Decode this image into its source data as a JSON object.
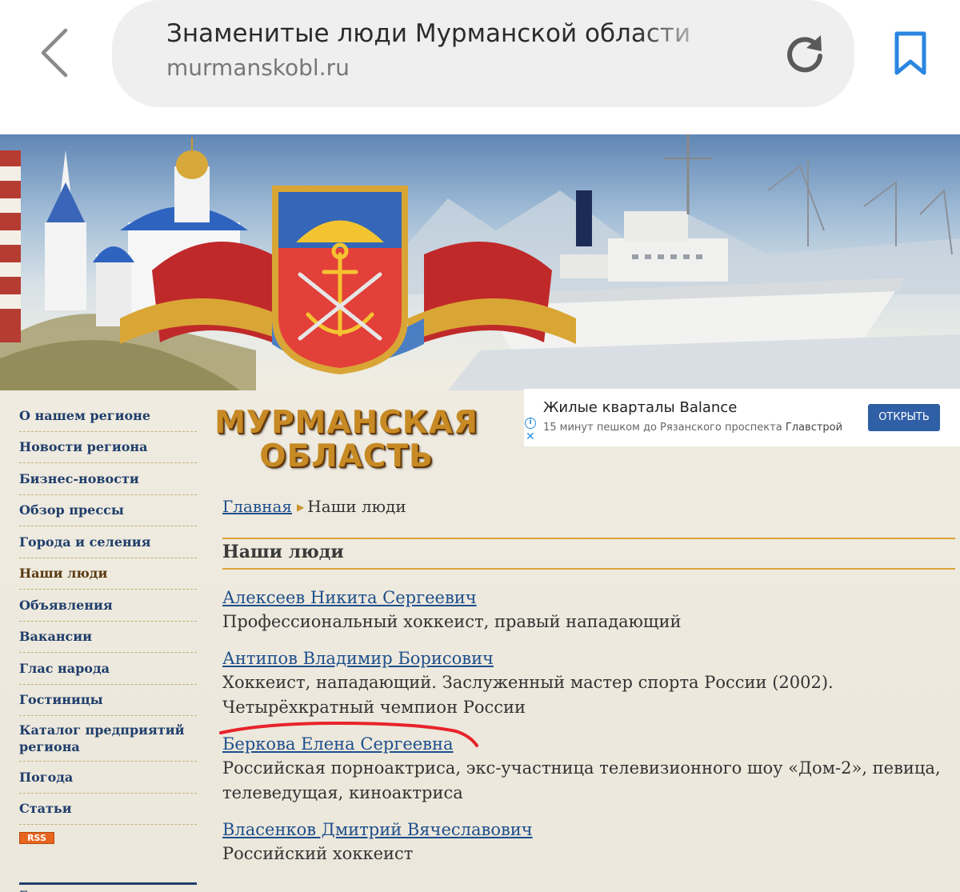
{
  "browser": {
    "page_title": "Знаменитые люди Мурманской области",
    "domain": "murmanskobl.ru"
  },
  "header": {
    "site_title_line1": "МУРМАНСКАЯ",
    "site_title_line2": "ОБЛАСТЬ"
  },
  "ad": {
    "title": "Жилые кварталы Balance",
    "subtitle": "15 минут пешком до Рязанского проспекта",
    "brand": "Главстрой",
    "button": "ОТКРЫТЬ",
    "info_symbol": "i",
    "close_symbol": "✕"
  },
  "sidebar": {
    "items": [
      {
        "label": "О нашем регионе"
      },
      {
        "label": "Новости региона"
      },
      {
        "label": "Бизнес-новости"
      },
      {
        "label": "Обзор прессы"
      },
      {
        "label": "Города и селения"
      },
      {
        "label": "Наши люди",
        "active": true
      },
      {
        "label": "Объявления"
      },
      {
        "label": "Вакансии"
      },
      {
        "label": "Глас народа"
      },
      {
        "label": "Гостиницы"
      },
      {
        "label": "Каталог предприятий региона"
      },
      {
        "label": "Погода"
      },
      {
        "label": "Статьи"
      }
    ],
    "rss_label": "RSS",
    "bottom_partial": "Г"
  },
  "breadcrumb": {
    "home": "Главная",
    "separator": "▶",
    "current": "Наши люди"
  },
  "section": {
    "title": "Наши люди"
  },
  "people": [
    {
      "name": "Алексеев Никита Сергеевич",
      "description": "Профессиональный хоккеист, правый нападающий"
    },
    {
      "name": "Антипов Владимир Борисович",
      "description": "Хоккеист, нападающий. Заслуженный мастер спорта России (2002). Четырёхкратный чемпион России"
    },
    {
      "name": "Беркова Елена Сергеевна",
      "description": "Российская порноактриса, экс-участница телевизионного шоу «Дом-2», певица, телеведущая, киноактриса"
    },
    {
      "name": "Власенков Дмитрий Вячеславович",
      "description": "Российский хоккеист"
    }
  ],
  "colors": {
    "link": "#1e4f8c",
    "gold_rule": "#d9a33a",
    "annotation_red": "#e8232b",
    "bookmark_blue": "#2a86e0"
  }
}
